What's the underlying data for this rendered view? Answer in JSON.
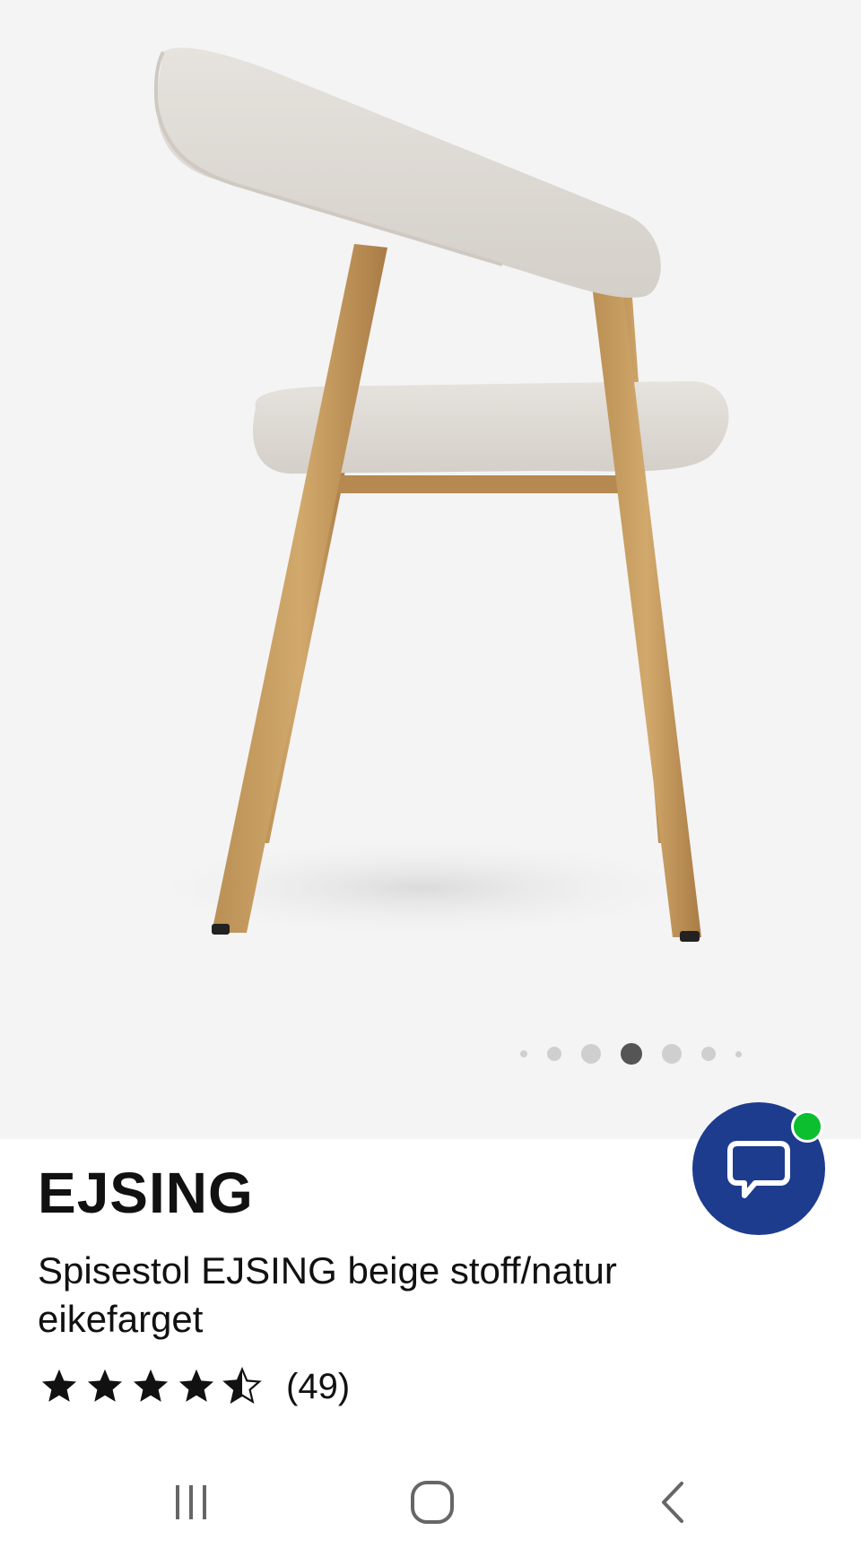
{
  "product": {
    "brand": "EJSING",
    "description": "Spisestol EJSING beige stoff/natur eikefarget",
    "rating": 4.5,
    "rating_max": 5,
    "review_count": "(49)"
  },
  "gallery": {
    "image": "product-image-chair-side-view",
    "total_images": 7,
    "current_index": 4
  },
  "chat": {
    "icon": "chat-bubble-icon",
    "status": "online",
    "color": "#1d3c8e",
    "status_color": "#0bbf2e"
  },
  "nav_bar": {
    "icons": [
      "recent-apps-icon",
      "home-icon",
      "back-icon"
    ]
  },
  "colors": {
    "gallery_background": "#f4f4f4",
    "active_dot": "#555555",
    "inactive_dot": "#cfcfcf",
    "text": "#111111"
  }
}
